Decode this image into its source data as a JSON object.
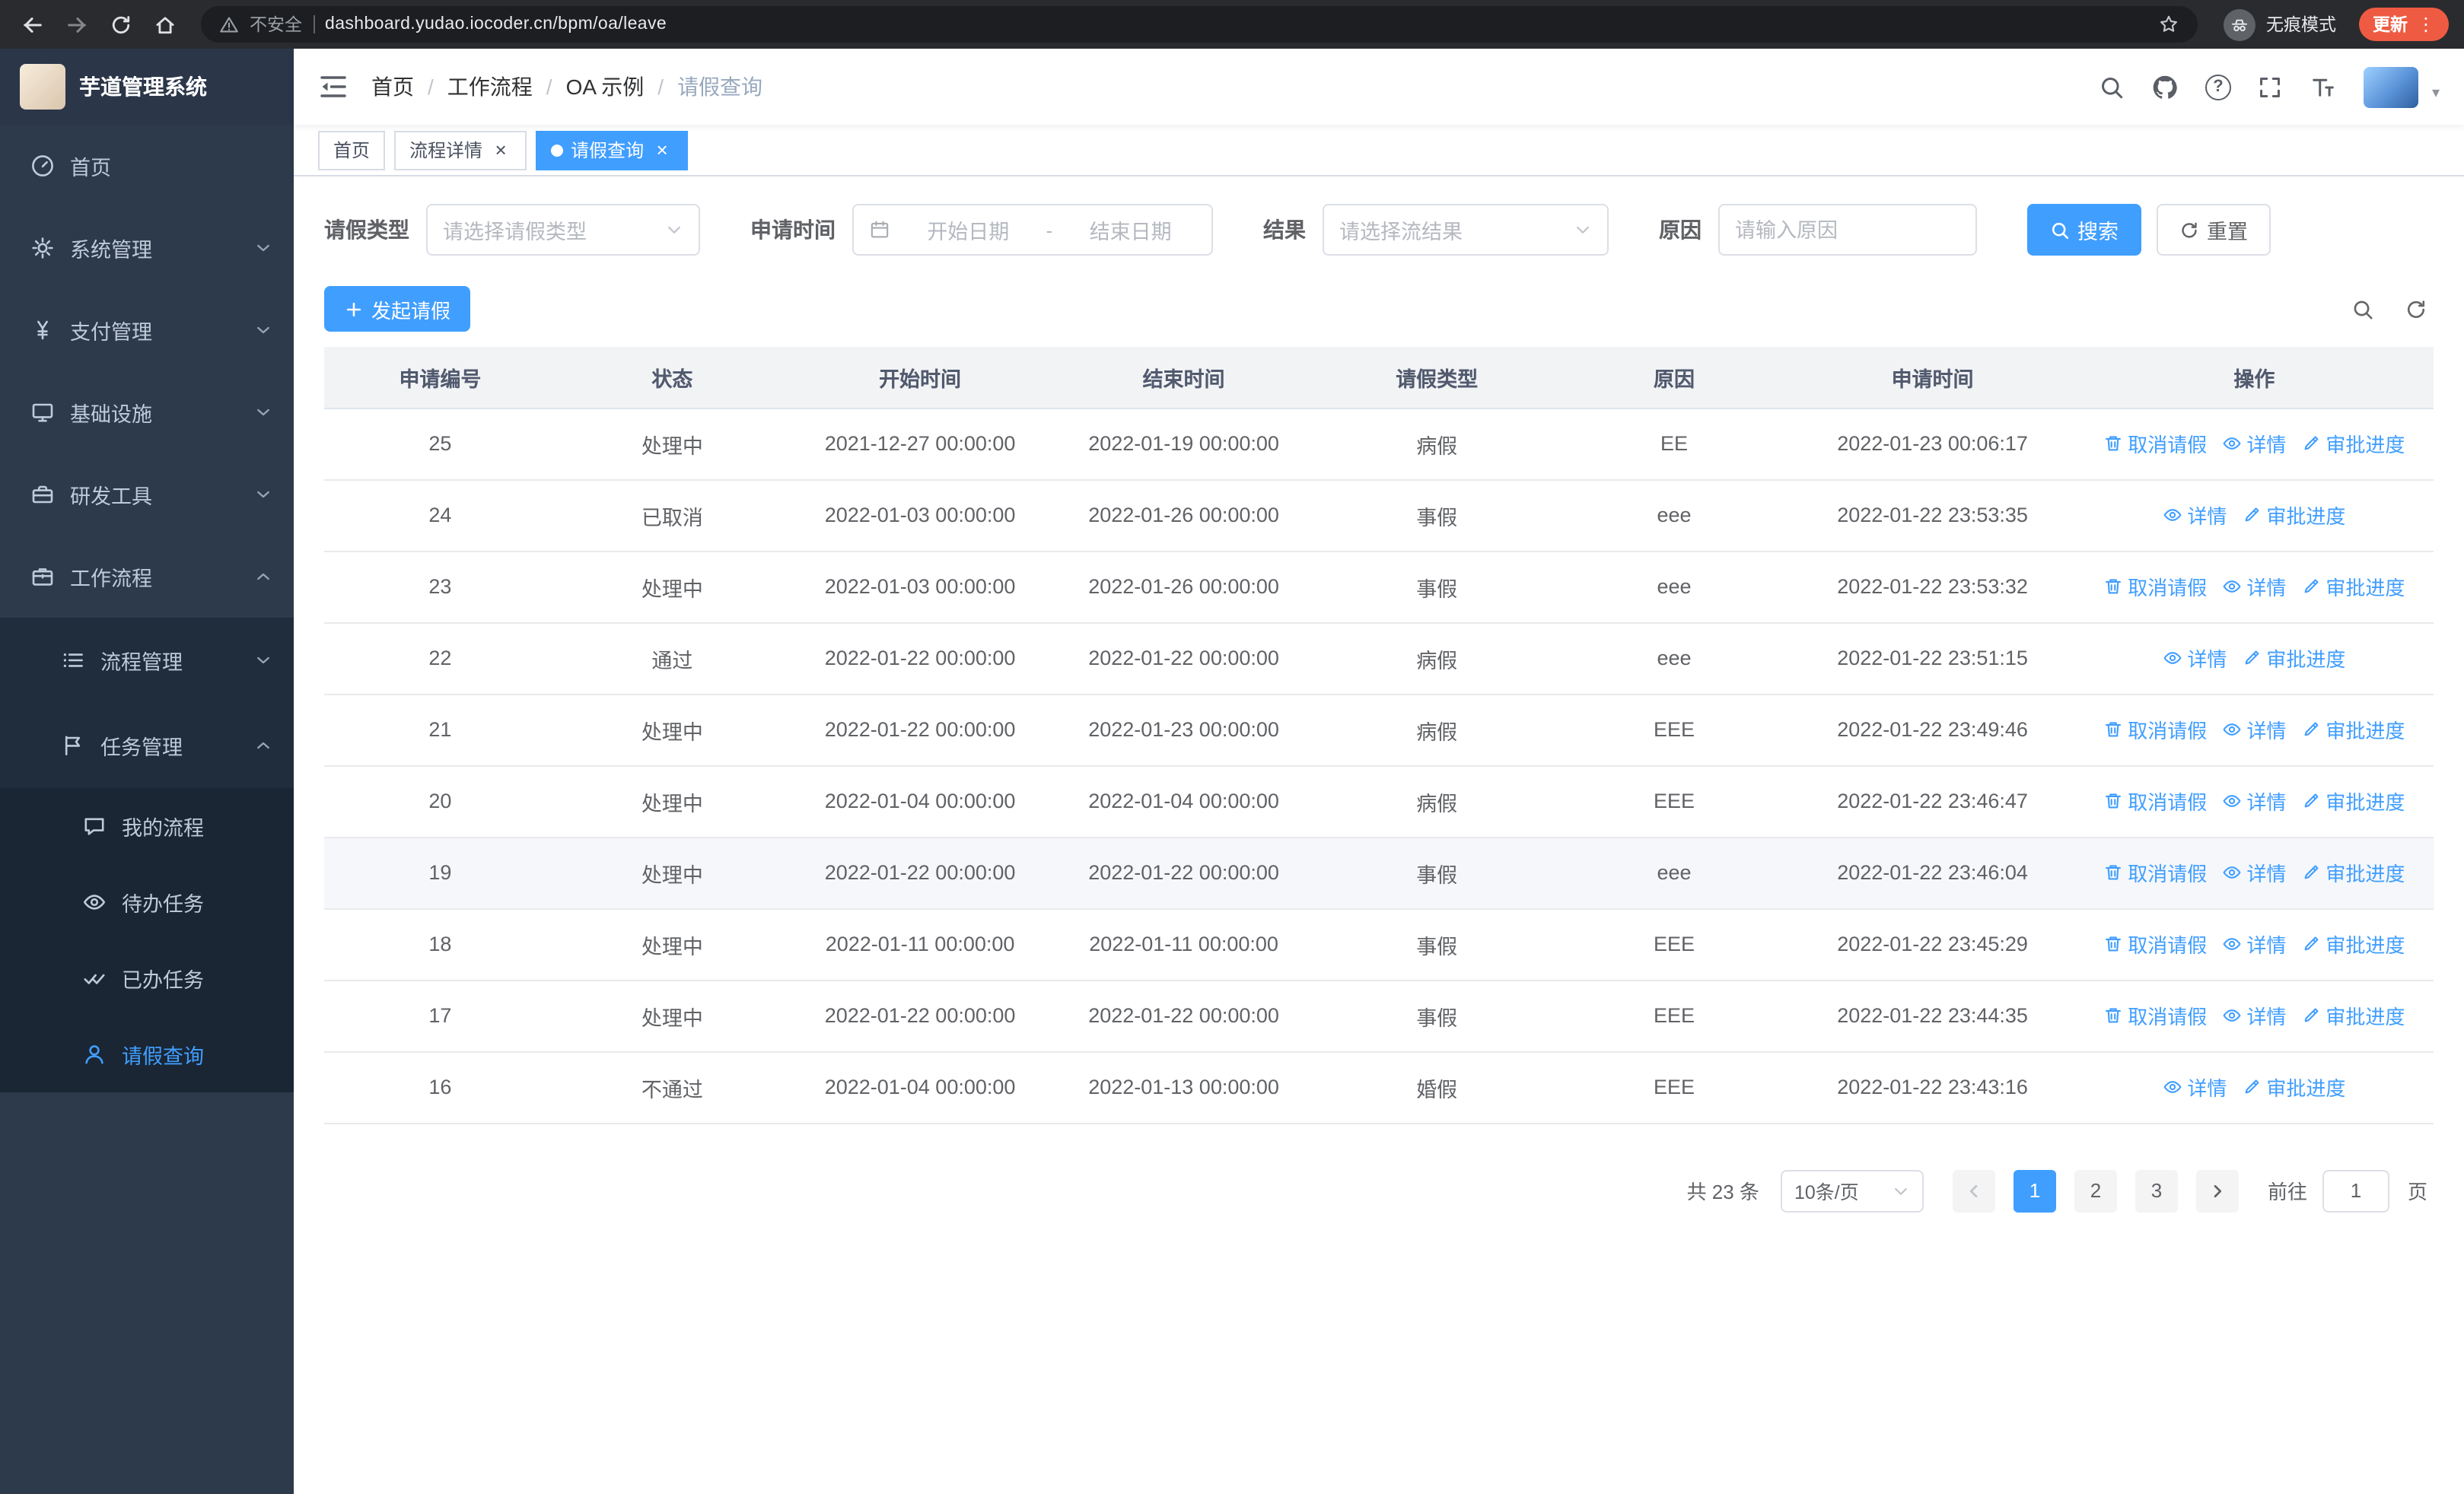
{
  "browser": {
    "security_label": "不安全",
    "url": "dashboard.yudao.iocoder.cn/bpm/oa/leave",
    "incognito_label": "无痕模式",
    "update_label": "更新"
  },
  "glyphs": {
    "breadcrumb_separator": "/",
    "close": "×",
    "dots": "⋮",
    "question": "?",
    "caret_down": "▾",
    "range_separator": "-"
  },
  "colors": {
    "accent": "#409EFF",
    "sidebar_bg": "#2D3A4B",
    "submenu_bg": "#1F2D3D",
    "update_button_bg": "#EE5B42"
  },
  "sidebar": {
    "logo_title": "芋道管理系统",
    "items": [
      {
        "label": "首页",
        "icon": "dashboard-icon",
        "expandable": false
      },
      {
        "label": "系统管理",
        "icon": "gear-icon",
        "expandable": true,
        "expanded": false
      },
      {
        "label": "支付管理",
        "icon": "yen-icon",
        "expandable": true,
        "expanded": false
      },
      {
        "label": "基础设施",
        "icon": "monitor-icon",
        "expandable": true,
        "expanded": false
      },
      {
        "label": "研发工具",
        "icon": "toolbox-icon",
        "expandable": true,
        "expanded": false
      },
      {
        "label": "工作流程",
        "icon": "briefcase-icon",
        "expandable": true,
        "expanded": true
      }
    ],
    "submenu": [
      {
        "label": "流程管理",
        "icon": "list-icon",
        "expandable": true,
        "expanded": false
      },
      {
        "label": "任务管理",
        "icon": "flag-icon",
        "expandable": true,
        "expanded": true
      }
    ],
    "task_items": [
      {
        "label": "我的流程",
        "icon": "message-icon",
        "active": false
      },
      {
        "label": "待办任务",
        "icon": "eye-icon",
        "active": false
      },
      {
        "label": "已办任务",
        "icon": "double-check-icon",
        "active": false
      },
      {
        "label": "请假查询",
        "icon": "user-icon",
        "active": true
      }
    ]
  },
  "header": {
    "breadcrumb": [
      "首页",
      "工作流程",
      "OA 示例",
      "请假查询"
    ]
  },
  "tabs": [
    {
      "label": "首页",
      "closable": false,
      "active": false
    },
    {
      "label": "流程详情",
      "closable": true,
      "active": false
    },
    {
      "label": "请假查询",
      "closable": true,
      "active": true
    }
  ],
  "filters": {
    "leave_type_label": "请假类型",
    "leave_type_placeholder": "请选择请假类型",
    "apply_time_label": "申请时间",
    "start_date_placeholder": "开始日期",
    "end_date_placeholder": "结束日期",
    "result_label": "结果",
    "result_placeholder": "请选择流结果",
    "reason_label": "原因",
    "reason_placeholder": "请输入原因",
    "search_label": "搜索",
    "reset_label": "重置"
  },
  "toolbar": {
    "create_label": "发起请假"
  },
  "table": {
    "columns": [
      "申请编号",
      "状态",
      "开始时间",
      "结束时间",
      "请假类型",
      "原因",
      "申请时间",
      "操作"
    ],
    "actions": {
      "cancel": "取消请假",
      "detail": "详情",
      "progress": "审批进度"
    },
    "rows": [
      {
        "id": "25",
        "status": "处理中",
        "start": "2021-12-27 00:00:00",
        "end": "2022-01-19 00:00:00",
        "type": "病假",
        "reason": "EE",
        "applied": "2022-01-23 00:06:17",
        "cancellable": true,
        "highlighted": false
      },
      {
        "id": "24",
        "status": "已取消",
        "start": "2022-01-03 00:00:00",
        "end": "2022-01-26 00:00:00",
        "type": "事假",
        "reason": "eee",
        "applied": "2022-01-22 23:53:35",
        "cancellable": false,
        "highlighted": false
      },
      {
        "id": "23",
        "status": "处理中",
        "start": "2022-01-03 00:00:00",
        "end": "2022-01-26 00:00:00",
        "type": "事假",
        "reason": "eee",
        "applied": "2022-01-22 23:53:32",
        "cancellable": true,
        "highlighted": false
      },
      {
        "id": "22",
        "status": "通过",
        "start": "2022-01-22 00:00:00",
        "end": "2022-01-22 00:00:00",
        "type": "病假",
        "reason": "eee",
        "applied": "2022-01-22 23:51:15",
        "cancellable": false,
        "highlighted": false
      },
      {
        "id": "21",
        "status": "处理中",
        "start": "2022-01-22 00:00:00",
        "end": "2022-01-23 00:00:00",
        "type": "病假",
        "reason": "EEE",
        "applied": "2022-01-22 23:49:46",
        "cancellable": true,
        "highlighted": false
      },
      {
        "id": "20",
        "status": "处理中",
        "start": "2022-01-04 00:00:00",
        "end": "2022-01-04 00:00:00",
        "type": "病假",
        "reason": "EEE",
        "applied": "2022-01-22 23:46:47",
        "cancellable": true,
        "highlighted": false
      },
      {
        "id": "19",
        "status": "处理中",
        "start": "2022-01-22 00:00:00",
        "end": "2022-01-22 00:00:00",
        "type": "事假",
        "reason": "eee",
        "applied": "2022-01-22 23:46:04",
        "cancellable": true,
        "highlighted": true
      },
      {
        "id": "18",
        "status": "处理中",
        "start": "2022-01-11 00:00:00",
        "end": "2022-01-11 00:00:00",
        "type": "事假",
        "reason": "EEE",
        "applied": "2022-01-22 23:45:29",
        "cancellable": true,
        "highlighted": false
      },
      {
        "id": "17",
        "status": "处理中",
        "start": "2022-01-22 00:00:00",
        "end": "2022-01-22 00:00:00",
        "type": "事假",
        "reason": "EEE",
        "applied": "2022-01-22 23:44:35",
        "cancellable": true,
        "highlighted": false
      },
      {
        "id": "16",
        "status": "不通过",
        "start": "2022-01-04 00:00:00",
        "end": "2022-01-13 00:00:00",
        "type": "婚假",
        "reason": "EEE",
        "applied": "2022-01-22 23:43:16",
        "cancellable": false,
        "highlighted": false
      }
    ]
  },
  "pagination": {
    "total_label": "共 23 条",
    "page_size": "10条/页",
    "pages": [
      "1",
      "2",
      "3"
    ],
    "current_page": "1",
    "goto_label": "前往",
    "goto_value": "1",
    "goto_suffix": "页"
  }
}
